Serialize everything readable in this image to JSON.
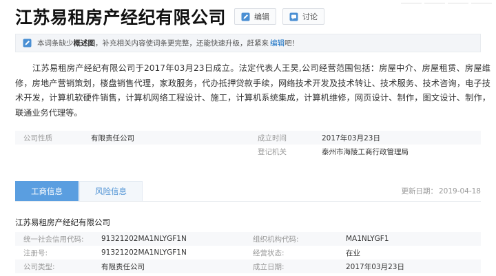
{
  "header": {
    "title": "江苏易租房产经纪有限公司",
    "edit_label": "编辑",
    "discuss_label": "讨论"
  },
  "notice": {
    "text_prefix": "本词条缺少",
    "highlight": "概述图",
    "text_middle": "，补充相关内容使词条更完整，还能快速升级，赶紧来",
    "link": "编辑",
    "text_suffix": "吧！"
  },
  "summary": "江苏易租房产经纪有限公司于2017年03月23日成立。法定代表人王昊,公司经营范围包括：房屋中介、房屋租赁、房屋维修，房地产营销策划，楼盘销售代理，家政服务，代办抵押贷款手续，网络技术开发及技术转让、技术服务、技术咨询，电子技术开发，计算机软硬件销售，计算机网络工程设计、施工，计算机系统集成，计算机维修，网页设计、制作，图文设计、制作，联通业务代理等。",
  "basic_info": [
    {
      "label1": "公司性质",
      "value1": "有限责任公司",
      "label2": "成立时间",
      "value2": "2017年03月23日"
    },
    {
      "label1": "",
      "value1": "",
      "label2": "登记机关",
      "value2": "泰州市海陵工商行政管理局"
    }
  ],
  "tabs": [
    {
      "label": "工商信息",
      "active": true
    },
    {
      "label": "风险信息",
      "active": false
    }
  ],
  "update": {
    "label": "更新日期：",
    "date": "2019-04-18"
  },
  "company_name": "江苏易租房产经纪有限公司",
  "registration": [
    {
      "label1": "统一社会信用代码:",
      "value1": "91321202MA1NLYGF1N",
      "label2": "组织机构代码:",
      "value2": "MA1NLYGF1"
    },
    {
      "label1": "注册号:",
      "value1": "91321202MA1NLYGF1N",
      "label2": "经营状态:",
      "value2": "在业"
    },
    {
      "label1": "公司类型:",
      "value1": "有限责任公司",
      "label2": "成立日期:",
      "value2": "2017年03月23日"
    }
  ],
  "colors": {
    "accent": "#5a9ee0",
    "link": "#136ec2"
  },
  "icons": {
    "edit": "pencil-icon",
    "discuss": "chat-icon",
    "notice": "edit-note-icon"
  }
}
